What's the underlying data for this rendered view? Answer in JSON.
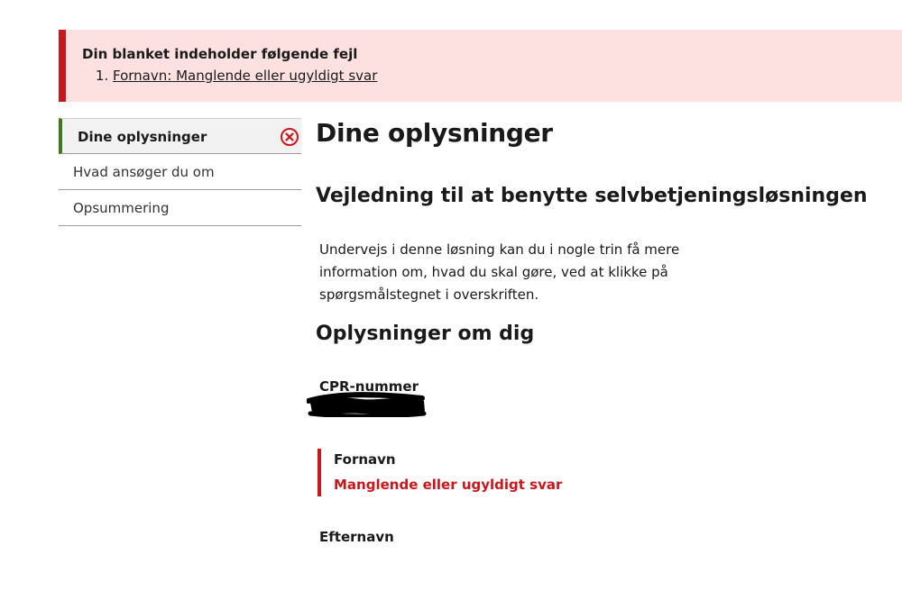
{
  "error_summary": {
    "title": "Din blanket indeholder følgende fejl",
    "items": [
      {
        "text": "Fornavn: Manglende eller ugyldigt svar"
      }
    ],
    "accent_color": "#c8161d",
    "background_color": "#fde1e1"
  },
  "sidenav": {
    "items": [
      {
        "label": "Dine oplysninger",
        "state": "active",
        "icon": "error-circle-icon"
      },
      {
        "label": "Hvad ansøger du om"
      },
      {
        "label": "Opsummering"
      }
    ],
    "active_color": "#3d7a1e"
  },
  "main": {
    "page_title": "Dine oplysninger",
    "guide_heading": "Vejledning til at benytte selvbetjeningsløsningen",
    "guide_text": "Undervejs i denne løsning kan du i nogle trin få mere information om, hvad du skal gøre, ved at klikke på spørgsmålstegnet i overskriften.",
    "info_heading": "Oplysninger om dig",
    "cpr_label": "CPR-nummer",
    "fornavn_label": "Fornavn",
    "fornavn_error": "Manglende eller ugyldigt svar",
    "efternavn_label": "Efternavn"
  }
}
